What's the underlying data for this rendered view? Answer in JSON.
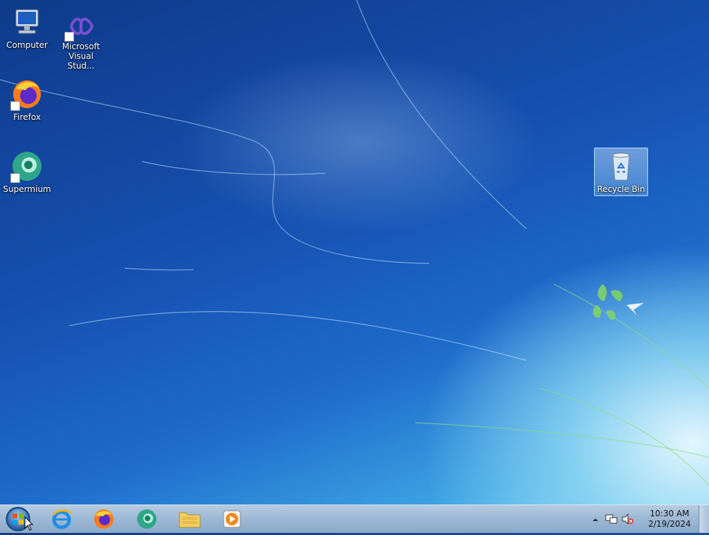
{
  "desktop": {
    "icons": [
      {
        "label": "Computer",
        "icon": "computer-icon"
      },
      {
        "label": "Microsoft Visual Stud...",
        "icon": "visual-studio-icon"
      },
      {
        "label": "Firefox",
        "icon": "firefox-icon"
      },
      {
        "label": "Supermium",
        "icon": "supermium-icon"
      },
      {
        "label": "Recycle Bin",
        "icon": "recycle-bin-icon",
        "selected": true
      }
    ]
  },
  "taskbar": {
    "start": {
      "icon": "windows-start-orb"
    },
    "pinned": [
      {
        "name": "Internet Explorer",
        "icon": "internet-explorer-icon"
      },
      {
        "name": "Firefox",
        "icon": "firefox-icon"
      },
      {
        "name": "Supermium",
        "icon": "supermium-icon"
      },
      {
        "name": "Windows Explorer",
        "icon": "folder-icon"
      },
      {
        "name": "Windows Media Player",
        "icon": "media-player-icon"
      }
    ],
    "tray": {
      "time": "10:30 AM",
      "date": "2/19/2024",
      "icons": [
        "show-hidden-icons-arrow",
        "network-icon",
        "volume-muted-icon"
      ]
    }
  },
  "colors": {
    "wallpaper_dark": "#0e3a8a",
    "wallpaper_light": "#8fd3f2",
    "taskbar": "#9fbad6",
    "selection": "#b4d7f5"
  }
}
